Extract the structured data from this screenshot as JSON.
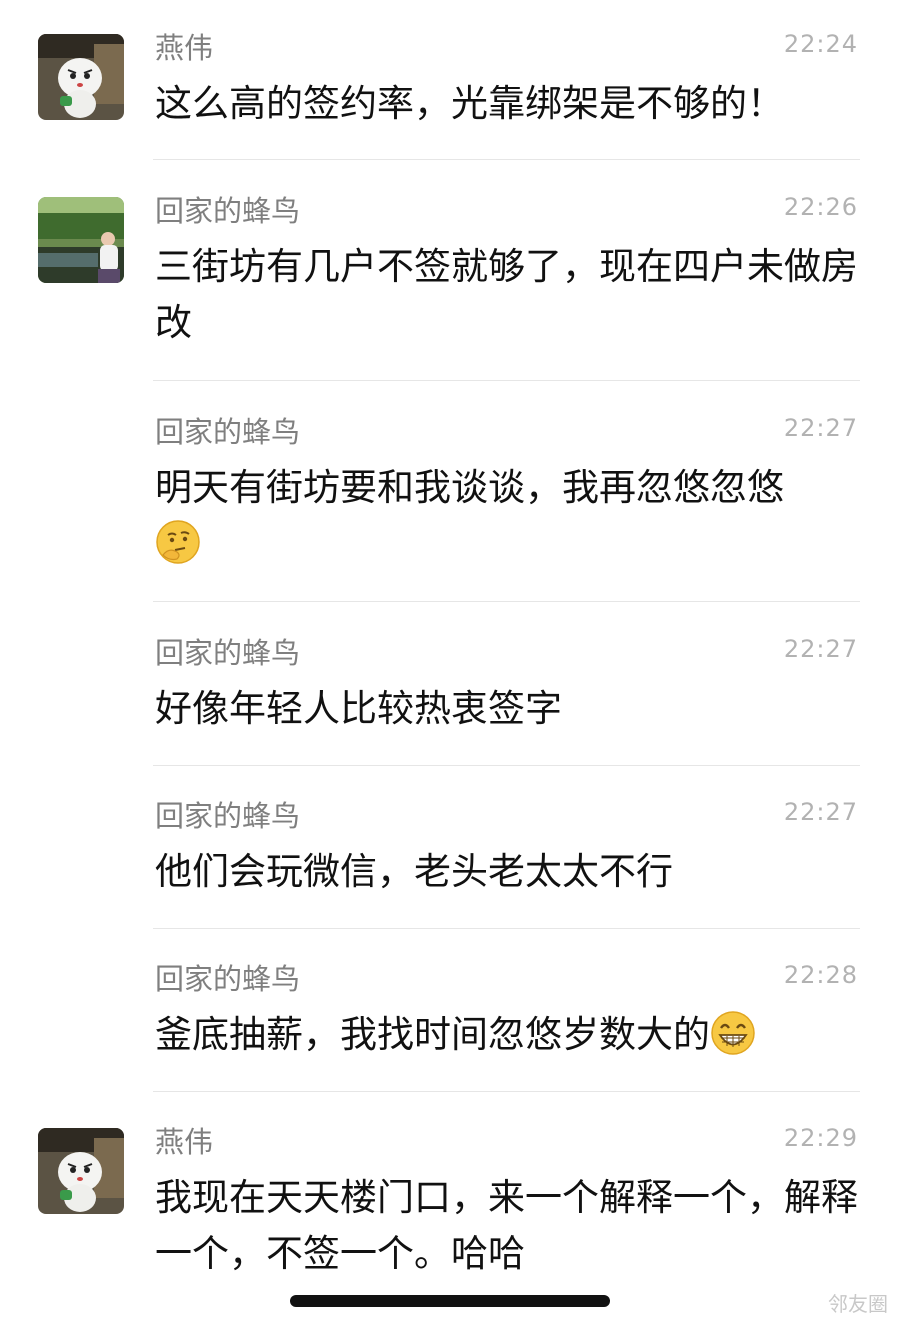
{
  "messages": [
    {
      "avatar": "cartoon-bear-avatar",
      "name": "燕伟",
      "time": "22:24",
      "text": "这么高的签约率，光靠绑架是不够的！"
    },
    {
      "avatar": "woman-by-lake-avatar",
      "name": "回家的蜂鸟",
      "time": "22:26",
      "text": "三街坊有几户不签就够了，现在四户未做房改"
    },
    {
      "name": "回家的蜂鸟",
      "time": "22:27",
      "text": "明天有街坊要和我谈谈，我再忽悠忽悠",
      "emoji": "thinking-face-emoji"
    },
    {
      "name": "回家的蜂鸟",
      "time": "22:27",
      "text": "好像年轻人比较热衷签字"
    },
    {
      "name": "回家的蜂鸟",
      "time": "22:27",
      "text": "他们会玩微信，老头老太太不行"
    },
    {
      "name": "回家的蜂鸟",
      "time": "22:28",
      "text": "釜底抽薪，我找时间忽悠岁数大的",
      "emoji": "grinning-face-emoji"
    },
    {
      "avatar": "cartoon-bear-avatar",
      "name": "燕伟",
      "time": "22:29",
      "text": "我现在天天楼门口，来一个解释一个，解释一个，不签一个。哈哈"
    }
  ],
  "watermark": "邻友圈",
  "colors": {
    "name": "#7f7f7f",
    "time": "#b2b2b2",
    "text": "#111111",
    "divider": "#e6e6e6"
  }
}
